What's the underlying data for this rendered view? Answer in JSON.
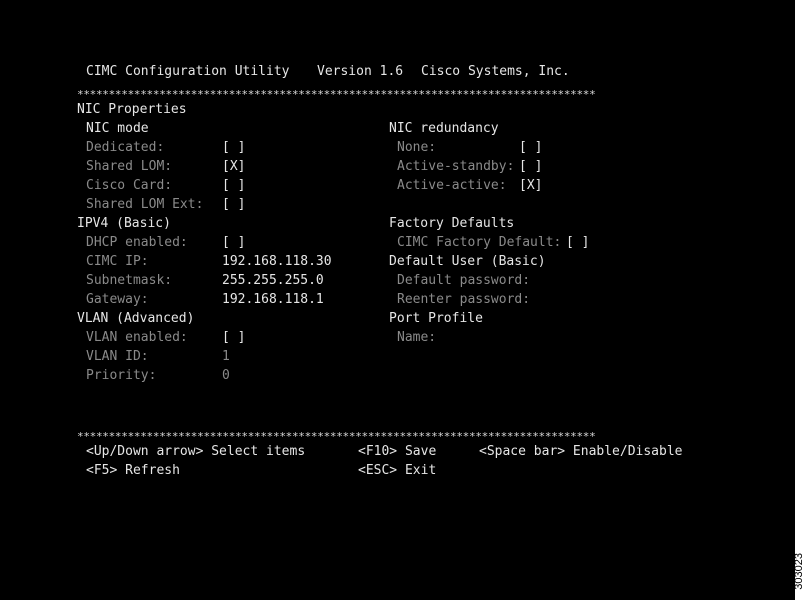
{
  "header": {
    "app_name": "CIMC Configuration Utility",
    "version": "Version 1.6",
    "vendor": "Cisco Systems, Inc."
  },
  "separator": "**********************************************************************************",
  "nic_properties": {
    "title": "NIC Properties",
    "nic_mode": {
      "title": "NIC mode",
      "options": [
        {
          "label": "Dedicated:",
          "value": "[ ]"
        },
        {
          "label": "Shared LOM:",
          "value": "[X]"
        },
        {
          "label": "Cisco Card:",
          "value": "[ ]"
        },
        {
          "label": "Shared LOM Ext:",
          "value": "[ ]"
        }
      ]
    },
    "nic_redundancy": {
      "title": "NIC redundancy",
      "options": [
        {
          "label": "None:",
          "value": "[ ]"
        },
        {
          "label": "Active-standby:",
          "value": "[ ]"
        },
        {
          "label": "Active-active:",
          "value": "[X]"
        }
      ]
    }
  },
  "ipv4": {
    "title": "IPV4 (Basic)",
    "fields": [
      {
        "label": "DHCP enabled:",
        "value": "[ ]"
      },
      {
        "label": "CIMC IP:",
        "value": "192.168.118.30"
      },
      {
        "label": "Subnetmask:",
        "value": "255.255.255.0"
      },
      {
        "label": "Gateway:",
        "value": "192.168.118.1"
      }
    ]
  },
  "factory_defaults": {
    "title": "Factory Defaults",
    "label": "CIMC Factory Default:",
    "value": "[ ]"
  },
  "default_user": {
    "title": "Default User (Basic)",
    "password_label": "Default password:",
    "reenter_label": "Reenter password:"
  },
  "vlan": {
    "title": "VLAN (Advanced)",
    "fields": [
      {
        "label": "VLAN enabled:",
        "value": "[ ]"
      },
      {
        "label": "VLAN ID:",
        "value": "1"
      },
      {
        "label": "Priority:",
        "value": "0"
      }
    ]
  },
  "port_profile": {
    "title": "Port Profile",
    "name_label": "Name:"
  },
  "footer": {
    "select_keys": "<Up/Down arrow> Select items",
    "save_keys": "<F10> Save",
    "toggle_keys": "<Space bar> Enable/Disable",
    "refresh_keys": "<F5> Refresh",
    "exit_keys": "<ESC> Exit"
  },
  "figure_id": "303023"
}
